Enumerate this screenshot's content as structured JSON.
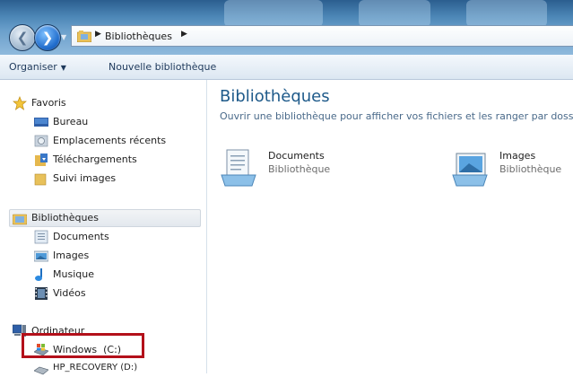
{
  "address_bar": {
    "breadcrumb": "Bibliothèques"
  },
  "command_bar": {
    "organize_label": "Organiser",
    "new_library_label": "Nouvelle bibliothèque"
  },
  "nav_pane": {
    "favorites": {
      "label": "Favoris",
      "items": [
        {
          "label": "Bureau",
          "icon": "desktop-icon"
        },
        {
          "label": "Emplacements récents",
          "icon": "recent-places-icon"
        },
        {
          "label": "Téléchargements",
          "icon": "downloads-icon"
        },
        {
          "label": "Suivi images",
          "icon": "folder-icon"
        }
      ]
    },
    "libraries": {
      "label": "Bibliothèques",
      "items": [
        {
          "label": "Documents",
          "icon": "documents-library-icon"
        },
        {
          "label": "Images",
          "icon": "pictures-library-icon"
        },
        {
          "label": "Musique",
          "icon": "music-library-icon"
        },
        {
          "label": "Vidéos",
          "icon": "videos-library-icon"
        }
      ]
    },
    "computer": {
      "label": "Ordinateur",
      "items": [
        {
          "label": "Windows  (C:)",
          "icon": "windows-drive-icon"
        },
        {
          "label": "HP_RECOVERY (D:)",
          "icon": "drive-icon"
        }
      ]
    }
  },
  "content": {
    "title": "Bibliothèques",
    "subtitle": "Ouvrir une bibliothèque pour afficher vos fichiers et les ranger par dossier,",
    "libraries": [
      {
        "name": "Documents",
        "kind": "Bibliothèque",
        "icon": "documents-library-icon"
      },
      {
        "name": "Images",
        "kind": "Bibliothèque",
        "icon": "pictures-library-icon"
      }
    ]
  },
  "colors": {
    "title_blue": "#1e5a8a",
    "highlight_red": "#b3101a",
    "glass_blue": "#4c86b6"
  }
}
